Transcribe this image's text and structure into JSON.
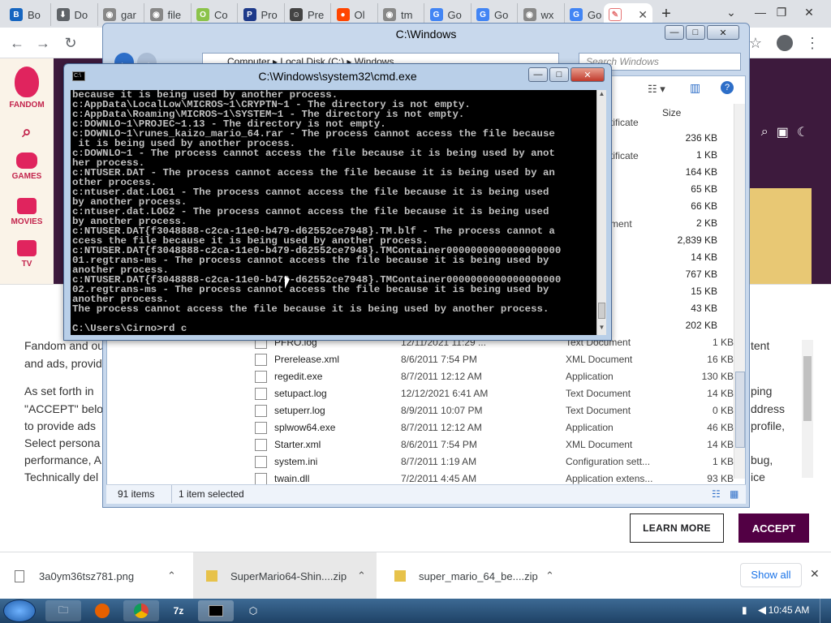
{
  "browser": {
    "tabs": [
      {
        "label": "Bo",
        "fav_color": "#1565c0",
        "fav_letter": "B"
      },
      {
        "label": "Do",
        "fav_color": "#5f6368",
        "fav_letter": "⬇"
      },
      {
        "label": "gar",
        "fav_color": "#888888",
        "fav_letter": "◉"
      },
      {
        "label": "file",
        "fav_color": "#888888",
        "fav_letter": "◉"
      },
      {
        "label": "Co",
        "fav_color": "#8bc34a",
        "fav_letter": "O"
      },
      {
        "label": "Pro",
        "fav_color": "#1e3a8a",
        "fav_letter": "P"
      },
      {
        "label": "Pre",
        "fav_color": "#444444",
        "fav_letter": "☺"
      },
      {
        "label": "Ol",
        "fav_color": "#ff4500",
        "fav_letter": "●"
      },
      {
        "label": "tm",
        "fav_color": "#888888",
        "fav_letter": "◉"
      },
      {
        "label": "Go",
        "fav_color": "#4285f4",
        "fav_letter": "G"
      },
      {
        "label": "Go",
        "fav_color": "#4285f4",
        "fav_letter": "G"
      },
      {
        "label": "wx",
        "fav_color": "#888888",
        "fav_letter": "◉"
      },
      {
        "label": "Go",
        "fav_color": "#4285f4",
        "fav_letter": "G"
      }
    ],
    "new_tab": "+"
  },
  "fandom": {
    "brand": "FANDOM",
    "rail": [
      {
        "label": "GAMES"
      },
      {
        "label": "MOVIES"
      },
      {
        "label": "TV"
      }
    ],
    "cookie_left": [
      "Fandom and ou",
      "and ads, provid",
      "As set forth in",
      "\"ACCEPT\" belo",
      "to provide ads",
      "Select persona",
      "performance, A",
      "Technically del"
    ],
    "cookie_right": [
      "tent",
      "",
      "ping",
      "ddress",
      "profile,",
      "",
      "bug,",
      "ice"
    ],
    "learn_more": "LEARN MORE",
    "accept": "ACCEPT"
  },
  "explorer": {
    "title": "C:\\Windows",
    "breadcrumb": [
      "Computer",
      "Local Disk (C:)",
      "Windows"
    ],
    "search_placeholder": "Search Windows",
    "col_size": "Size",
    "partial_types": [
      "tificate",
      "tificate",
      "ment"
    ],
    "upper_sizes": [
      "236 KB",
      "1 KB",
      "164 KB",
      "65 KB",
      "66 KB",
      "2 KB",
      "2,839 KB",
      "14 KB",
      "767 KB",
      "15 KB",
      "43 KB",
      "202 KB"
    ],
    "rows": [
      {
        "name": "PFRO.log",
        "date": "12/11/2021 11:29 ...",
        "type": "Text Document",
        "size": "1 KB"
      },
      {
        "name": "Prerelease.xml",
        "date": "8/6/2011 7:54 PM",
        "type": "XML Document",
        "size": "16 KB"
      },
      {
        "name": "regedit.exe",
        "date": "8/7/2011 12:12 AM",
        "type": "Application",
        "size": "130 KB"
      },
      {
        "name": "setupact.log",
        "date": "12/12/2021 6:41 AM",
        "type": "Text Document",
        "size": "14 KB"
      },
      {
        "name": "setuperr.log",
        "date": "8/9/2011 10:07 PM",
        "type": "Text Document",
        "size": "0 KB"
      },
      {
        "name": "splwow64.exe",
        "date": "8/7/2011 12:12 AM",
        "type": "Application",
        "size": "46 KB"
      },
      {
        "name": "Starter.xml",
        "date": "8/6/2011 7:54 PM",
        "type": "XML Document",
        "size": "14 KB"
      },
      {
        "name": "system.ini",
        "date": "8/7/2011 1:19 AM",
        "type": "Configuration sett...",
        "size": "1 KB"
      },
      {
        "name": "twain.dll",
        "date": "7/2/2011 4:45 AM",
        "type": "Application extens...",
        "size": "93 KB"
      }
    ],
    "status_count": "91 items",
    "status_selected": "1 item selected"
  },
  "cmd": {
    "title": "C:\\Windows\\system32\\cmd.exe",
    "lines": [
      "because it is being used by another process.",
      "c:AppData\\LocalLow\\MICROS~1\\CRYPTN~1 - The directory is not empty.",
      "c:AppData\\Roaming\\MICROS~1\\SYSTEM~1 - The directory is not empty.",
      "c:DOWNLO~1\\PROJEC~1.13 - The directory is not empty.",
      "c:DOWNLO~1\\runes_kaizo_mario_64.rar - The process cannot access the file because",
      " it is being used by another process.",
      "c:DOWNLO~1 - The process cannot access the file because it is being used by anot",
      "her process.",
      "c:NTUSER.DAT - The process cannot access the file because it is being used by an",
      "other process.",
      "c:ntuser.dat.LOG1 - The process cannot access the file because it is being used",
      "by another process.",
      "c:ntuser.dat.LOG2 - The process cannot access the file because it is being used",
      "by another process.",
      "c:NTUSER.DAT{f3048888-c2ca-11e0-b479-d62552ce7948}.TM.blf - The process cannot a",
      "ccess the file because it is being used by another process.",
      "c:NTUSER.DAT{f3048888-c2ca-11e0-b479-d62552ce7948}.TMContainer0000000000000000000",
      "01.regtrans-ms - The process cannot access the file because it is being used by",
      "another process.",
      "c:NTUSER.DAT{f3048888-c2ca-11e0-b479-d62552ce7948}.TMContainer0000000000000000000",
      "02.regtrans-ms - The process cannot access the file because it is being used by",
      "another process.",
      "The process cannot access the file because it is being used by another process.",
      "",
      "C:\\Users\\Cirno>rd c"
    ]
  },
  "downloads": [
    {
      "name": "3a0ym36tsz781.png"
    },
    {
      "name": "SuperMario64-Shin....zip"
    },
    {
      "name": "super_mario_64_be....zip"
    }
  ],
  "show_all": "Show all",
  "taskbar": {
    "clock": "10:45 AM"
  }
}
